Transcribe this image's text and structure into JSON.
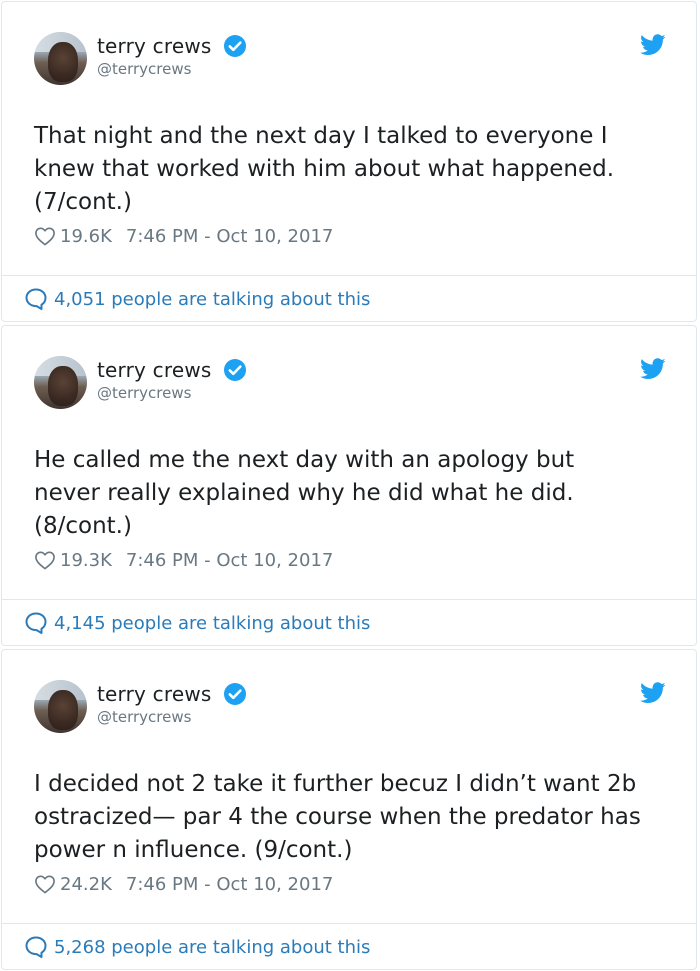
{
  "colors": {
    "accent": "#1da1f2",
    "link": "#2b7bb9",
    "muted": "#697882",
    "text": "#1c2022",
    "border": "#e1e8ed"
  },
  "icons": {
    "verified": "verified-badge-icon",
    "bird": "twitter-bird-icon",
    "like": "heart-icon",
    "reply": "speech-bubble-icon"
  },
  "tweets": [
    {
      "name": "terry crews",
      "handle": "@terrycrews",
      "text": "That night and the next day I talked to everyone I\nknew that worked with him about what happened.\n(7/cont.)",
      "likes": "19.6K",
      "timestamp": "7:46 PM - Oct 10, 2017",
      "talking": "4,051 people are talking about this"
    },
    {
      "name": "terry crews",
      "handle": "@terrycrews",
      "text": "He called me the next day with an apology but\nnever really explained why he did what he did.\n(8/cont.)",
      "likes": "19.3K",
      "timestamp": "7:46 PM - Oct 10, 2017",
      "talking": "4,145 people are talking about this"
    },
    {
      "name": "terry crews",
      "handle": "@terrycrews",
      "text": "I decided not 2 take it further becuz I didn’t want 2b\nostracized— par 4 the course when the predator has\npower n influence. (9/cont.)",
      "likes": "24.2K",
      "timestamp": "7:46 PM - Oct 10, 2017",
      "talking": "5,268 people are talking about this"
    }
  ]
}
